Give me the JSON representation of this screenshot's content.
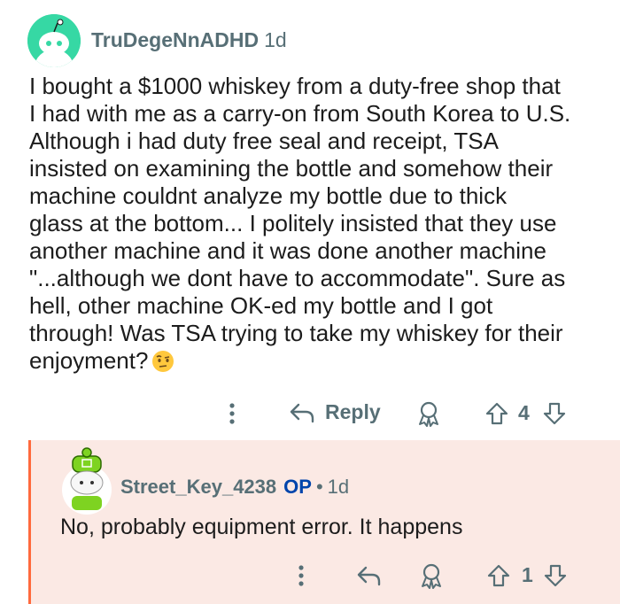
{
  "comment": {
    "author": "TruDegeNnADHD",
    "age": "1d",
    "body": "I bought a $1000 whiskey from a duty-free shop that\nI had with me as a carry-on from South Korea to U.S.\nAlthough i had duty free seal and receipt, TSA\ninsisted on examining the bottle and somehow their\nmachine couldnt analyze my bottle due to thick\nglass at the bottom... I politely insisted that they use\nanother machine and it was done another machine\n\"...although we dont have to accommodate\". Sure as\nhell, other machine OK-ed my bottle and I got\nthrough! Was TSA trying to take my whiskey for their\nenjoyment?",
    "emoji_icon": "raised-eyebrow-emoji-icon",
    "actions": {
      "reply_label": "Reply",
      "vote_count": "4"
    }
  },
  "reply": {
    "author": "Street_Key_4238",
    "op_badge": "OP",
    "separator": "•",
    "age": "1d",
    "body": "No, probably equipment error. It happens",
    "actions": {
      "vote_count": "1"
    }
  },
  "colors": {
    "accent_border": "#ff6a3d",
    "reply_bg": "#fbe9e4",
    "op_blue": "#0045ac",
    "meta_gray": "#576f76"
  }
}
